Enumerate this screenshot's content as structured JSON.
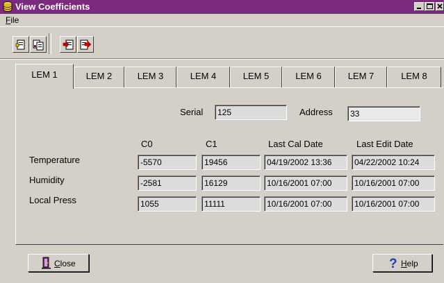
{
  "window": {
    "title": "View Coefficients",
    "colors": {
      "titlebar": "#7b2a7d",
      "face": "#d4d0c8"
    }
  },
  "menu": {
    "file": "File"
  },
  "toolbar": {
    "buttons": [
      {
        "icon": "page-copy-icon"
      },
      {
        "icon": "page-paste-icon"
      },
      {
        "icon": "import-icon"
      },
      {
        "icon": "export-icon"
      }
    ]
  },
  "tabs": [
    "LEM 1",
    "LEM 2",
    "LEM 3",
    "LEM 4",
    "LEM 5",
    "LEM 6",
    "LEM 7",
    "LEM 8"
  ],
  "active_tab": "LEM 1",
  "device": {
    "serial_label": "Serial",
    "serial_value": "125",
    "address_label": "Address",
    "address_value": "33"
  },
  "table": {
    "headers": [
      "C0",
      "C1",
      "Last Cal Date",
      "Last Edit Date"
    ],
    "rows": [
      {
        "name": "Temperature",
        "c0": "-5570",
        "c1": "19456",
        "cal": "04/19/2002 13:36",
        "edit": "04/22/2002 10:24"
      },
      {
        "name": "Humidity",
        "c0": "-2581",
        "c1": "16129",
        "cal": "10/16/2001 07:00",
        "edit": "10/16/2001 07:00"
      },
      {
        "name": "Local Press",
        "c0": "1055",
        "c1": "11111",
        "cal": "10/16/2001 07:00",
        "edit": "10/16/2001 07:00"
      }
    ]
  },
  "buttons": {
    "close": "Close",
    "help": "Help"
  }
}
